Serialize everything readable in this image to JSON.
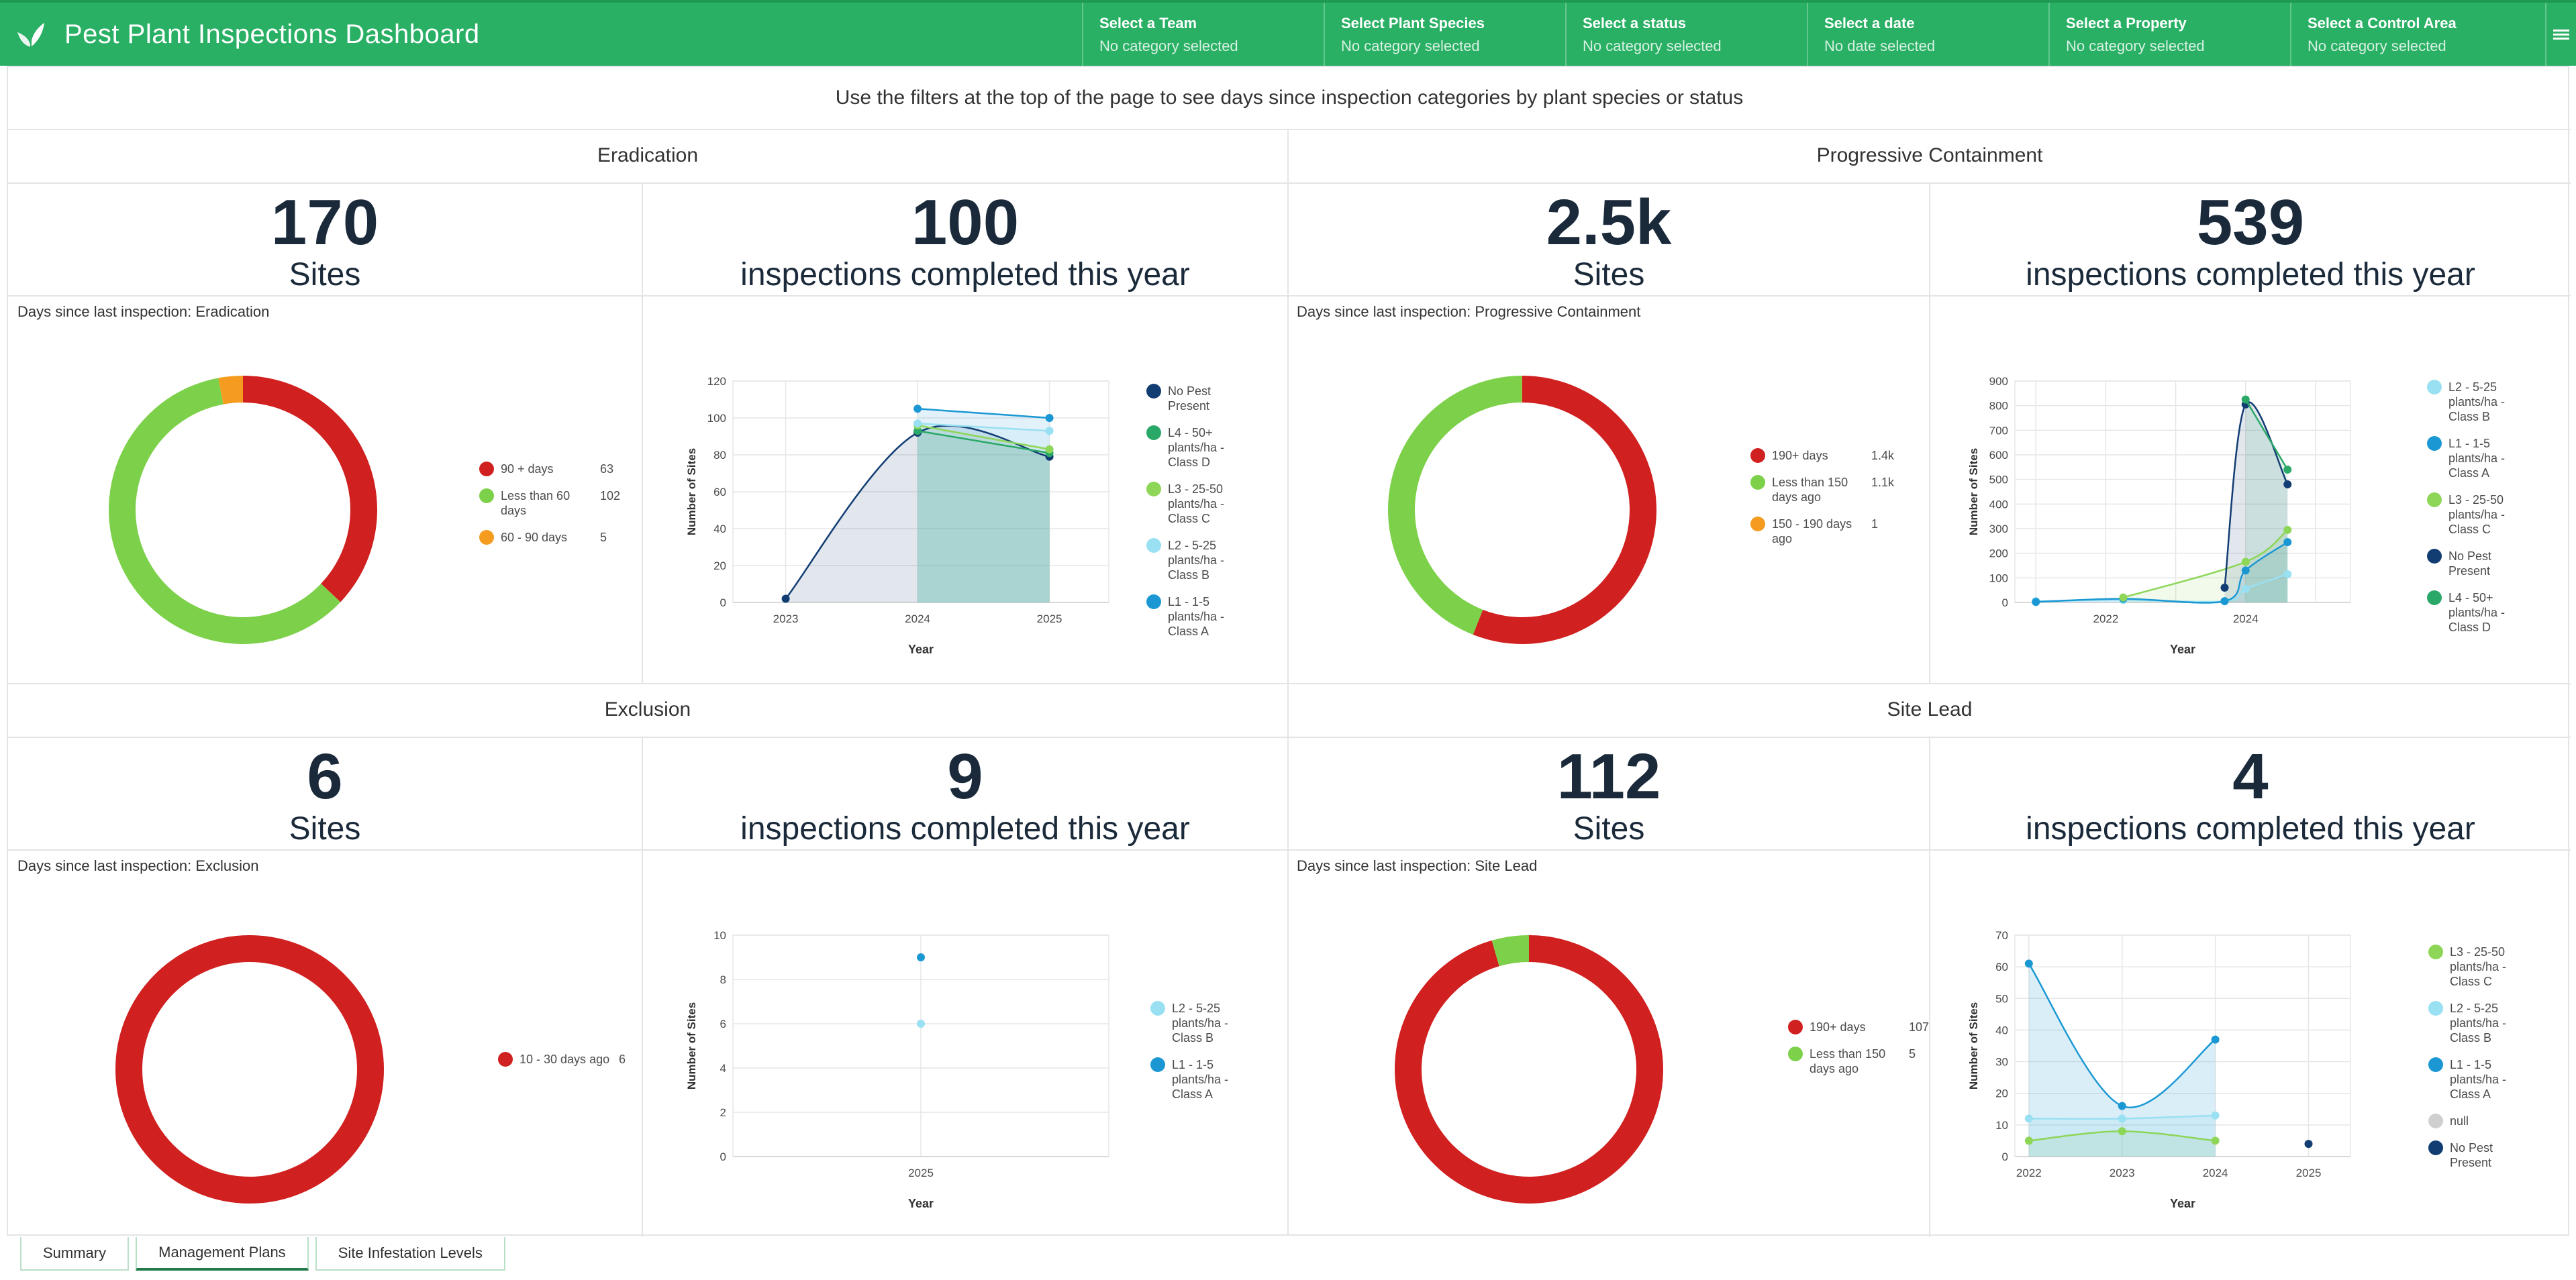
{
  "header": {
    "title": "Pest Plant Inspections Dashboard",
    "logo_icon": "leaf-icon",
    "brand_color": "#29b064",
    "selectors": [
      {
        "label": "Select a Team",
        "value": "No category selected"
      },
      {
        "label": "Select Plant Species",
        "value": "No category selected"
      },
      {
        "label": "Select a status",
        "value": "No category selected"
      },
      {
        "label": "Select a date",
        "value": "No date selected"
      },
      {
        "label": "Select a Property",
        "value": "No category selected"
      },
      {
        "label": "Select a Control Area",
        "value": "No category selected"
      }
    ],
    "menu_icon": "hamburger-menu-icon"
  },
  "filter_note": "Use the filters at the top of the page to see days since inspection categories by plant species or status",
  "sections": {
    "eradication": {
      "title": "Eradication",
      "sites_value": "170",
      "sites_label": "Sites",
      "inspections_value": "100",
      "inspections_label": "inspections completed this year",
      "donut_caption": "Days since last inspection: Eradication",
      "donut_legend": [
        {
          "label": "90 + days",
          "value": "63",
          "color": "#d0201f"
        },
        {
          "label": "Less than 60 days",
          "value": "102",
          "color": "#7dd14a"
        },
        {
          "label": "60 - 90 days",
          "value": "5",
          "color": "#f59b1f"
        }
      ],
      "line_legend": [
        {
          "label": "No Pest Present",
          "color": "#123d73"
        },
        {
          "label": "L4 - 50+ plants/ha - Class D",
          "color": "#2aa867"
        },
        {
          "label": "L3 - 25-50 plants/ha - Class C",
          "color": "#8dd657"
        },
        {
          "label": "L2 - 5-25 plants/ha - Class B",
          "color": "#99e0f2"
        },
        {
          "label": "L1 - 1-5 plants/ha - Class A",
          "color": "#1b98d3"
        }
      ]
    },
    "progressive": {
      "title": "Progressive Containment",
      "sites_value": "2.5k",
      "sites_label": "Sites",
      "inspections_value": "539",
      "inspections_label": "inspections completed this year",
      "donut_caption": "Days since last inspection: Progressive Containment",
      "donut_legend": [
        {
          "label": "190+ days",
          "value": "1.4k",
          "color": "#d0201f"
        },
        {
          "label": "Less than 150 days ago",
          "value": "1.1k",
          "color": "#7dd14a"
        },
        {
          "label": "150 - 190 days ago",
          "value": "1",
          "color": "#f59b1f"
        }
      ],
      "line_legend": [
        {
          "label": "L2 - 5-25 plants/ha - Class B",
          "color": "#99e0f2"
        },
        {
          "label": "L1 - 1-5 plants/ha - Class A",
          "color": "#1b98d3"
        },
        {
          "label": "L3 - 25-50 plants/ha - Class C",
          "color": "#8dd657"
        },
        {
          "label": "No Pest Present",
          "color": "#123d73"
        },
        {
          "label": "L4 - 50+ plants/ha - Class D",
          "color": "#2aa867"
        }
      ]
    },
    "exclusion": {
      "title": "Exclusion",
      "sites_value": "6",
      "sites_label": "Sites",
      "inspections_value": "9",
      "inspections_label": "inspections completed this year",
      "donut_caption": "Days since last inspection: Exclusion",
      "donut_legend": [
        {
          "label": "10 - 30 days ago",
          "value": "6",
          "color": "#d0201f"
        }
      ],
      "line_legend": [
        {
          "label": "L2 - 5-25 plants/ha - Class B",
          "color": "#99e0f2"
        },
        {
          "label": "L1 - 1-5 plants/ha - Class A",
          "color": "#1b98d3"
        }
      ]
    },
    "sitelead": {
      "title": "Site Lead",
      "sites_value": "112",
      "sites_label": "Sites",
      "inspections_value": "4",
      "inspections_label": "inspections completed this year",
      "donut_caption": "Days since last inspection: Site Lead",
      "donut_legend": [
        {
          "label": "190+ days",
          "value": "107",
          "color": "#d0201f"
        },
        {
          "label": "Less than 150 days ago",
          "value": "5",
          "color": "#7dd14a"
        }
      ],
      "line_legend": [
        {
          "label": "L3 - 25-50 plants/ha - Class C",
          "color": "#8dd657"
        },
        {
          "label": "L2 - 5-25 plants/ha - Class B",
          "color": "#99e0f2"
        },
        {
          "label": "L1 - 1-5 plants/ha - Class A",
          "color": "#1b98d3"
        },
        {
          "label": "null",
          "color": "#cfcfcf"
        },
        {
          "label": "No Pest Present",
          "color": "#123d73"
        }
      ]
    }
  },
  "tabs": [
    {
      "label": "Summary",
      "active": false
    },
    {
      "label": "Management Plans",
      "active": true
    },
    {
      "label": "Site Infestation Levels",
      "active": false
    }
  ],
  "chart_data": [
    {
      "id": "eradication-donut",
      "type": "pie",
      "categories": [
        "90 + days",
        "Less than 60 days",
        "60 - 90 days"
      ],
      "values": [
        63,
        102,
        5
      ],
      "colors": [
        "#d0201f",
        "#7dd14a",
        "#f59b1f"
      ],
      "title": "Days since last inspection: Eradication"
    },
    {
      "id": "eradication-line",
      "type": "area",
      "x": [
        2023,
        2024,
        2025
      ],
      "xlabel": "Year",
      "ylabel": "Number of Sites",
      "ylim": [
        0,
        120
      ],
      "yticks": [
        0,
        20,
        40,
        60,
        80,
        100,
        120
      ],
      "grid": true,
      "legend": "right",
      "series": [
        {
          "name": "No Pest Present",
          "color": "#123d73",
          "values": [
            2,
            92,
            79
          ]
        },
        {
          "name": "L4 - 50+ plants/ha - Class D",
          "color": "#2aa867",
          "values": [
            null,
            93,
            81
          ]
        },
        {
          "name": "L3 - 25-50 plants/ha - Class C",
          "color": "#8dd657",
          "values": [
            null,
            96,
            83
          ]
        },
        {
          "name": "L2 - 5-25 plants/ha - Class B",
          "color": "#99e0f2",
          "values": [
            null,
            97,
            93
          ]
        },
        {
          "name": "L1 - 1-5 plants/ha - Class A",
          "color": "#1b98d3",
          "values": [
            null,
            105,
            100
          ]
        }
      ]
    },
    {
      "id": "progressive-donut",
      "type": "pie",
      "categories": [
        "190+ days",
        "Less than 150 days ago",
        "150 - 190 days ago"
      ],
      "values": [
        1400,
        1100,
        1
      ],
      "colors": [
        "#d0201f",
        "#7dd14a",
        "#f59b1f"
      ],
      "title": "Days since last inspection: Progressive Containment"
    },
    {
      "id": "progressive-line",
      "type": "area",
      "x": [
        2021,
        2022,
        2023,
        2024,
        2025
      ],
      "xticks": [
        2022,
        2024
      ],
      "xlabel": "Year",
      "ylabel": "Number of Sites",
      "ylim": [
        0,
        900
      ],
      "yticks": [
        0,
        100,
        200,
        300,
        400,
        500,
        600,
        700,
        800,
        900
      ],
      "grid": true,
      "legend": "right",
      "series": [
        {
          "name": "L2 - 5-25 plants/ha - Class B",
          "color": "#99e0f2",
          "values": [
            5,
            10,
            5,
            55,
            115
          ]
        },
        {
          "name": "L1 - 1-5 plants/ha - Class A",
          "color": "#1b98d3",
          "values": [
            2,
            15,
            5,
            130,
            245
          ]
        },
        {
          "name": "L3 - 25-50 plants/ha - Class C",
          "color": "#8dd657",
          "values": [
            null,
            20,
            null,
            165,
            295
          ]
        },
        {
          "name": "No Pest Present",
          "color": "#123d73",
          "values": [
            null,
            null,
            60,
            805,
            480
          ]
        },
        {
          "name": "L4 - 50+ plants/ha - Class D",
          "color": "#2aa867",
          "values": [
            null,
            null,
            null,
            825,
            540
          ]
        }
      ],
      "x_positions": [
        2021,
        2022.25,
        2023.7,
        2024,
        2024.6
      ]
    },
    {
      "id": "exclusion-donut",
      "type": "pie",
      "categories": [
        "10 - 30 days ago"
      ],
      "values": [
        6
      ],
      "colors": [
        "#d0201f"
      ],
      "title": "Days since last inspection: Exclusion"
    },
    {
      "id": "exclusion-scatter",
      "type": "scatter",
      "x": [
        2025
      ],
      "xlabel": "Year",
      "ylabel": "Number of Sites",
      "ylim": [
        0,
        10
      ],
      "yticks": [
        0,
        2,
        4,
        6,
        8,
        10
      ],
      "grid": true,
      "legend": "right",
      "series": [
        {
          "name": "L2 - 5-25 plants/ha - Class B",
          "color": "#99e0f2",
          "values": [
            6
          ]
        },
        {
          "name": "L1 - 1-5 plants/ha - Class A",
          "color": "#1b98d3",
          "values": [
            9
          ]
        }
      ]
    },
    {
      "id": "sitelead-donut",
      "type": "pie",
      "categories": [
        "190+ days",
        "Less than 150 days ago"
      ],
      "values": [
        107,
        5
      ],
      "colors": [
        "#d0201f",
        "#7dd14a"
      ],
      "title": "Days since last inspection: Site Lead"
    },
    {
      "id": "sitelead-line",
      "type": "area",
      "x": [
        2022,
        2023,
        2024,
        2025
      ],
      "xlabel": "Year",
      "ylabel": "Number of Sites",
      "ylim": [
        0,
        70
      ],
      "yticks": [
        0,
        10,
        20,
        30,
        40,
        50,
        60,
        70
      ],
      "grid": true,
      "legend": "right",
      "series": [
        {
          "name": "L3 - 25-50 plants/ha - Class C",
          "color": "#8dd657",
          "values": [
            5,
            8,
            5,
            null
          ]
        },
        {
          "name": "L2 - 5-25 plants/ha - Class B",
          "color": "#99e0f2",
          "values": [
            12,
            12,
            13,
            null
          ]
        },
        {
          "name": "L1 - 1-5 plants/ha - Class A",
          "color": "#1b98d3",
          "values": [
            61,
            16,
            37,
            null
          ]
        },
        {
          "name": "null",
          "color": "#cfcfcf",
          "values": [
            null,
            null,
            null,
            null
          ]
        },
        {
          "name": "No Pest Present",
          "color": "#123d73",
          "values": [
            null,
            null,
            null,
            4
          ]
        }
      ]
    }
  ]
}
